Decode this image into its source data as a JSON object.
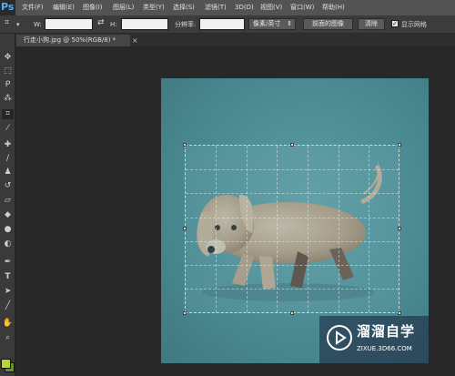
{
  "app": {
    "logo_text": "Ps"
  },
  "menu": [
    "文件(F)",
    "编辑(E)",
    "图像(I)",
    "图层(L)",
    "类型(Y)",
    "选择(S)",
    "滤镜(T)",
    "3D(D)",
    "视图(V)",
    "窗口(W)",
    "帮助(H)"
  ],
  "options": {
    "w_label": "W:",
    "h_label": "H:",
    "resolution_label": "分辨率:",
    "unit_select": "像素/英寸",
    "front_image_button": "前面的图像",
    "clear_button": "清除",
    "show_grid_label": "显示网格",
    "show_grid_checked": true
  },
  "document_tab": {
    "title": "行走小狗.jpg @ 50%(RGB/8) *",
    "close": "×"
  },
  "tools": [
    "move",
    "marquee",
    "lasso",
    "magic-wand",
    "crop",
    "eyedropper",
    "healing",
    "brush",
    "stamp",
    "history",
    "eraser",
    "gradient",
    "blur",
    "dodge",
    "pen",
    "type",
    "path-select",
    "shape",
    "hand",
    "zoom"
  ],
  "colors": {
    "foreground": "#b7d43a",
    "background": "#6b8f2a",
    "accent": "#4fb2ff"
  },
  "watermark": {
    "title": "溜溜自学",
    "url": "ZIXUE.3D66.COM"
  }
}
